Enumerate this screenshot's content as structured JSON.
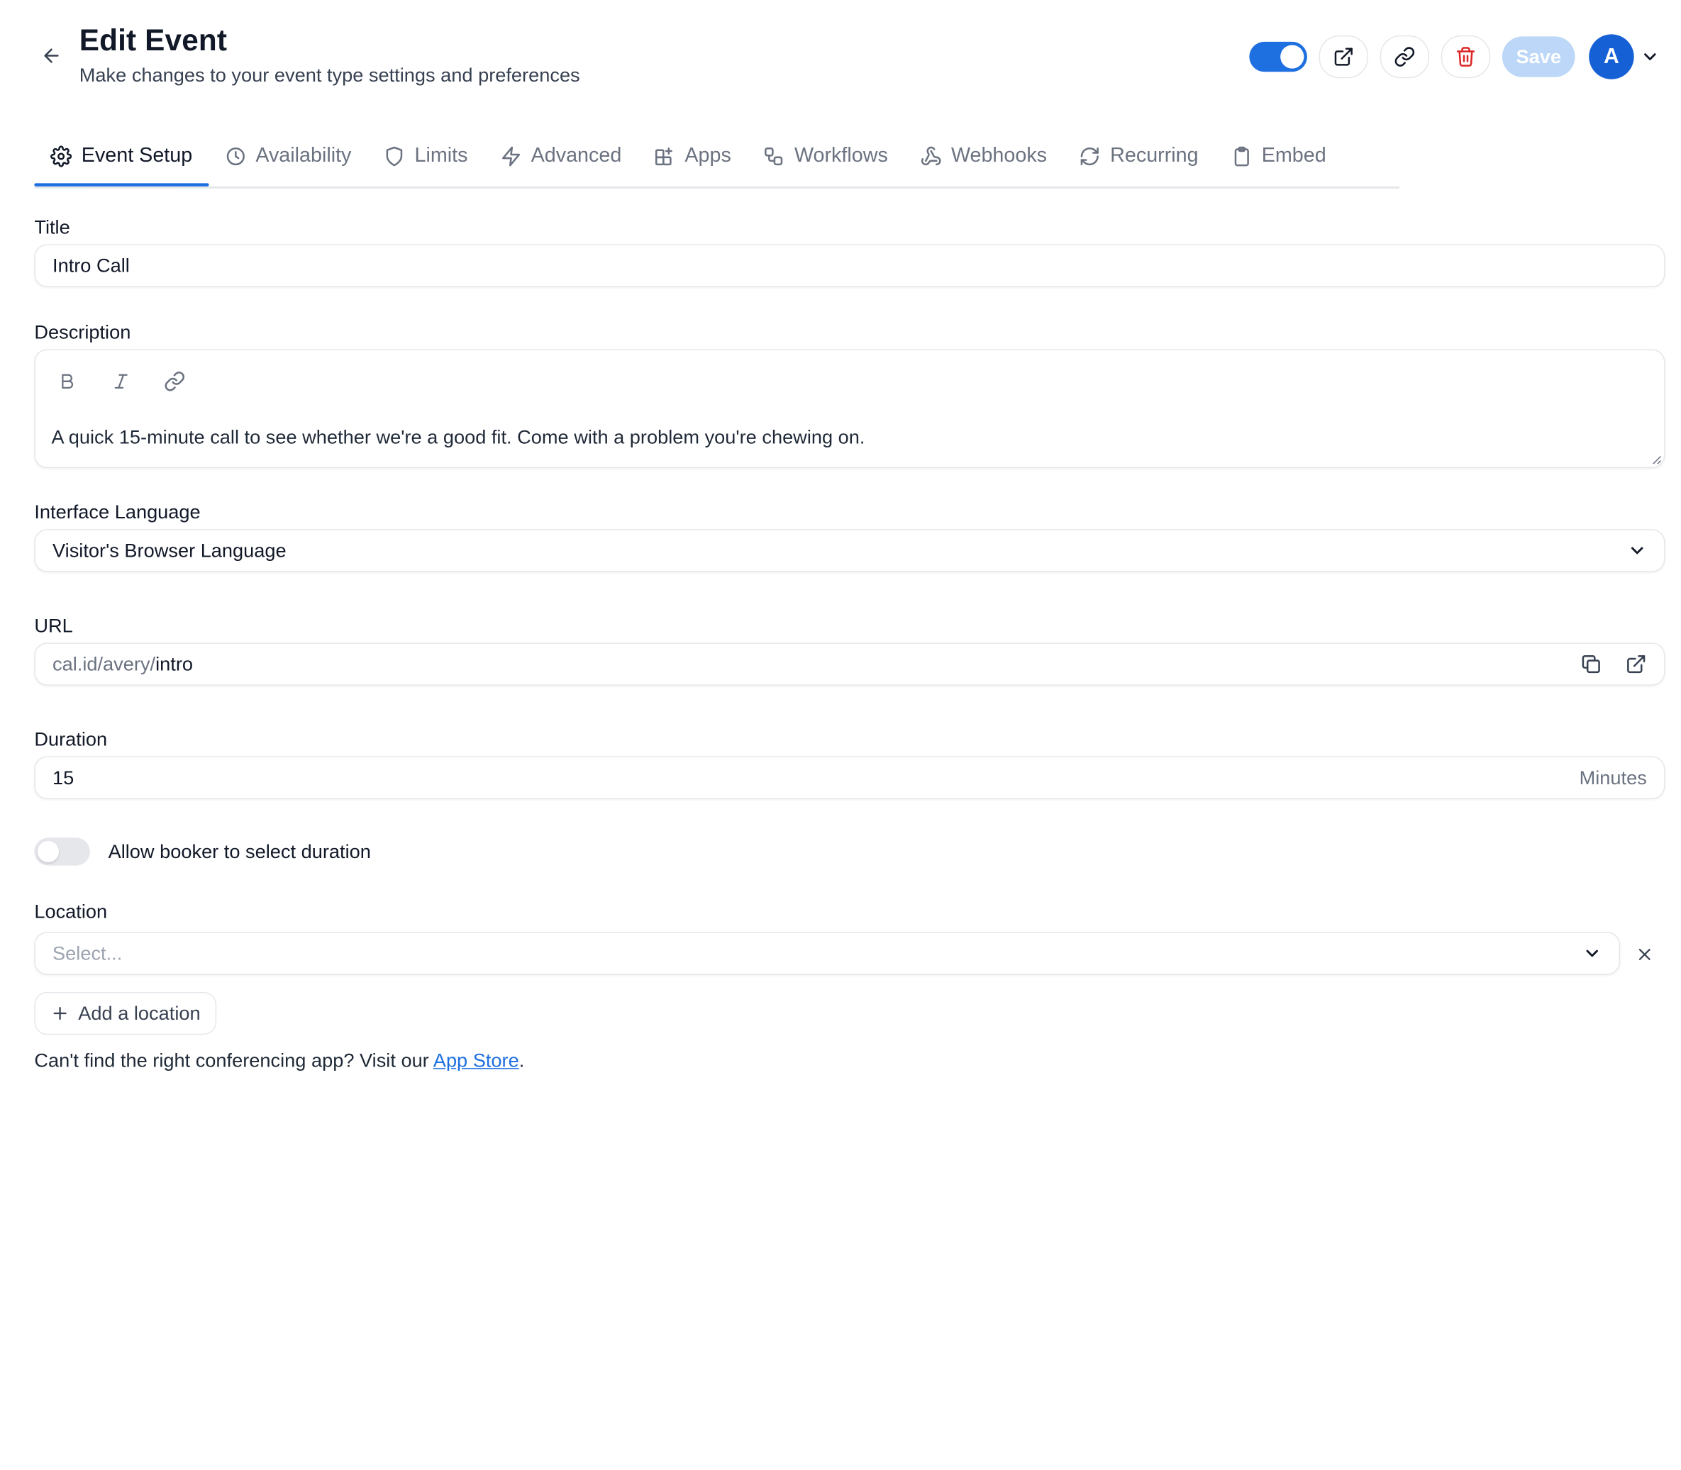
{
  "header": {
    "title": "Edit Event",
    "subtitle": "Make changes to your event type settings and preferences",
    "save_label": "Save",
    "avatar_initial": "A",
    "accent_color": "#1e6fe0",
    "hidden_toggle_on": true
  },
  "tabs": [
    {
      "label": "Event Setup",
      "icon": "gear-icon",
      "active": true
    },
    {
      "label": "Availability",
      "icon": "clock-icon"
    },
    {
      "label": "Limits",
      "icon": "shield-icon"
    },
    {
      "label": "Advanced",
      "icon": "bolt-icon"
    },
    {
      "label": "Apps",
      "icon": "grid-plus-icon"
    },
    {
      "label": "Workflows",
      "icon": "workflow-icon"
    },
    {
      "label": "Webhooks",
      "icon": "webhook-icon"
    },
    {
      "label": "Recurring",
      "icon": "refresh-icon"
    },
    {
      "label": "Embed",
      "icon": "clipboard-icon"
    }
  ],
  "form": {
    "title_label": "Title",
    "title_value": "Intro Call",
    "description_label": "Description",
    "description_value": "A quick 15-minute call to see whether we're a good fit. Come with a problem you're chewing on.",
    "language_label": "Interface Language",
    "language_value": "Visitor's Browser Language",
    "url_label": "URL",
    "url_prefix": "cal.id/avery/",
    "url_slug": "intro",
    "duration_label": "Duration",
    "duration_value": "15",
    "duration_unit": "Minutes",
    "booker_duration_label": "Allow booker to select duration",
    "booker_duration_on": false,
    "location_label": "Location",
    "location_placeholder": "Select...",
    "add_location_label": "Add a location",
    "help_prefix": "Can't find the right conferencing app? Visit our ",
    "help_link": "App Store",
    "help_suffix": "."
  }
}
